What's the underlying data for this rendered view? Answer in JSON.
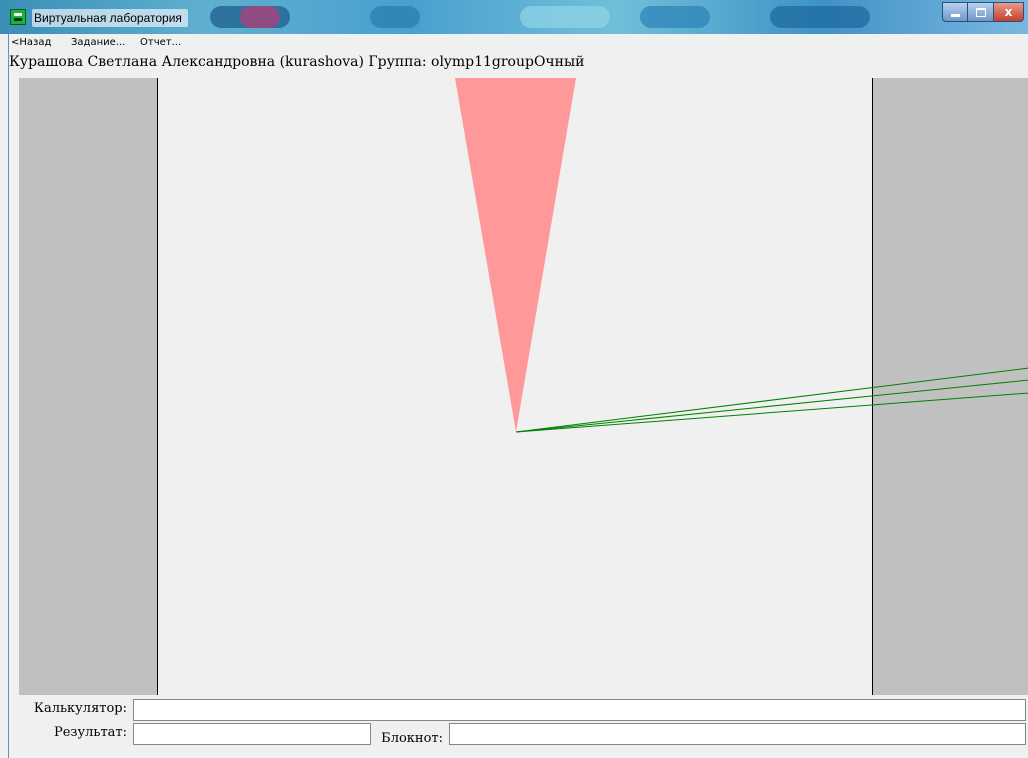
{
  "window": {
    "title": "Виртуальная лаборатория",
    "icon": "lab-app-icon",
    "controls": [
      "minimize-icon",
      "maximize-icon",
      "close-icon"
    ],
    "close_glyph": "x"
  },
  "menu": {
    "back": "<Назад",
    "task": "Задание...",
    "report": "Отчет..."
  },
  "user": {
    "line": "Курашова Светлана Александровна (kurashova)  Группа: olymp11groupОчный"
  },
  "scene": {
    "background": "#f0f0f0",
    "side_panel_color": "#c0c0c0",
    "divider_color": "#000000",
    "cone_color": "#ff9999",
    "ray_color": "#008000",
    "ray_count": 3
  },
  "fields": {
    "calculator_label": "Калькулятор:",
    "calculator_value": "",
    "result_label": "Результат:",
    "result_value": "",
    "notepad_label": "Блокнот:",
    "notepad_value": ""
  }
}
